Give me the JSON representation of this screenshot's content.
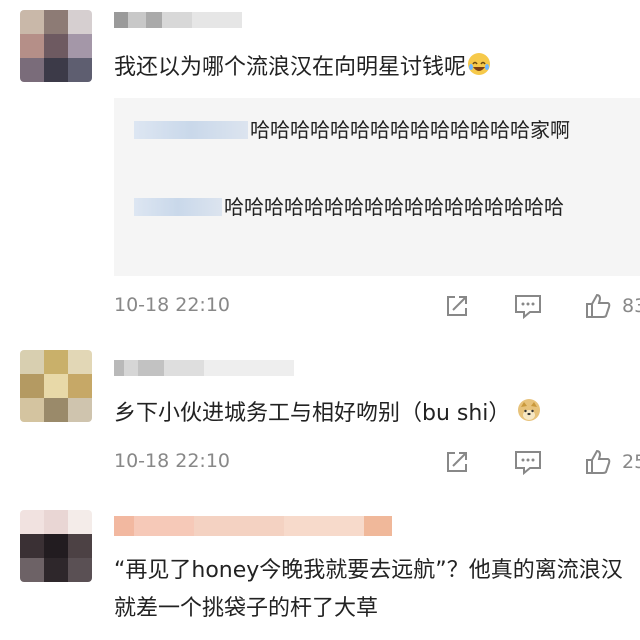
{
  "comments": [
    {
      "text": "我还以为哪个流浪汉在向明星讨钱呢",
      "emoji": "laughing-crying-emoji",
      "replies": [
        {
          "text": "哈哈哈哈哈哈哈哈哈哈哈哈哈哈家啊"
        },
        {
          "text": "哈哈哈哈哈哈哈哈哈哈哈哈哈哈哈哈哈"
        }
      ],
      "time": "10-18 22:10",
      "like_count": "83"
    },
    {
      "text": "乡下小伙进城务工与相好吻别（bu shi）",
      "emoji": "doge-emoji",
      "time": "10-18 22:10",
      "like_count": "25"
    },
    {
      "text": "“再见了honey今晚我就要去远航”？他真的离流浪汉就差一个挑袋子的杆了大草"
    }
  ],
  "colors": {
    "meta_gray": "#888888",
    "reply_bg": "#f5f5f5",
    "text": "#222222"
  }
}
